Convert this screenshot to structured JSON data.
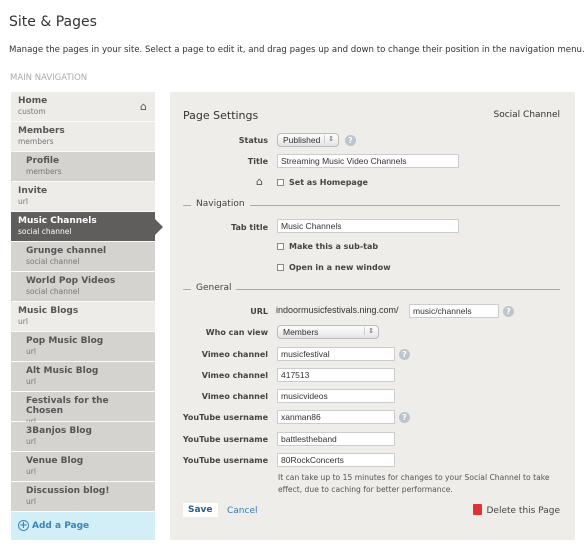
{
  "page": {
    "title": "Site & Pages",
    "description": "Manage the pages in your site. Select a page to edit it, and drag pages up and down to change their position in the navigation menu.",
    "nav_heading": "MAIN NAVIGATION"
  },
  "sidebar": {
    "items": [
      {
        "name": "Home",
        "type": "custom"
      },
      {
        "name": "Members",
        "type": "members"
      },
      {
        "name": "Profile",
        "type": "members"
      },
      {
        "name": "Invite",
        "type": "url"
      },
      {
        "name": "Music Channels",
        "type": "social channel"
      },
      {
        "name": "Grunge channel",
        "type": "social channel"
      },
      {
        "name": "World Pop Videos",
        "type": "social channel"
      },
      {
        "name": "Music Blogs",
        "type": "url"
      },
      {
        "name": "Pop Music Blog",
        "type": "url"
      },
      {
        "name": "Alt Music Blog",
        "type": "url"
      },
      {
        "name": "Festivals for the Chosen",
        "type": "url"
      },
      {
        "name": "3Banjos Blog",
        "type": "url"
      },
      {
        "name": "Venue Blog",
        "type": "url"
      },
      {
        "name": "Discussion blog!",
        "type": "url"
      }
    ],
    "add_label": "Add a Page"
  },
  "settings": {
    "heading": "Page Settings",
    "page_type": "Social Channel",
    "status_label": "Status",
    "status_value": "Published",
    "title_label": "Title",
    "title_value": "Streaming Music Video Channels",
    "homepage_label": "Set as Homepage",
    "navigation_heading": "Navigation",
    "tab_title_label": "Tab title",
    "tab_title_value": "Music Channels",
    "subtab_label": "Make this a sub-tab",
    "new_window_label": "Open in a new window",
    "general_heading": "General",
    "url_label": "URL",
    "url_prefix": "indoormusicfestivals.ning.com/",
    "url_value": "music/channels",
    "who_label": "Who can view",
    "who_value": "Members",
    "fields": [
      {
        "label": "Vimeo channel",
        "value": "musicfestival"
      },
      {
        "label": "Vimeo channel",
        "value": "417513"
      },
      {
        "label": "Vimeo channel",
        "value": "musicvideos"
      },
      {
        "label": "YouTube username",
        "value": "xanman86"
      },
      {
        "label": "YouTube username",
        "value": "battlestheband"
      },
      {
        "label": "YouTube username",
        "value": "80RockConcerts"
      }
    ],
    "note": "It can take up to 15 minutes for changes to your Social Channel to take effect, due to caching for better performance.",
    "save": "Save",
    "cancel": "Cancel",
    "delete": "Delete this Page"
  }
}
